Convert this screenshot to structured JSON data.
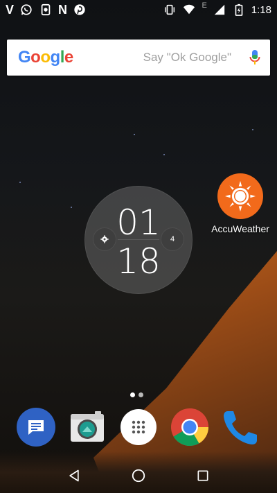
{
  "status_bar": {
    "left_icons": [
      "vodafone-v-icon",
      "whatsapp-icon",
      "screenshot-icon",
      "news-n-icon",
      "pinterest-icon"
    ],
    "v_letter": "V",
    "n_letter": "N",
    "network_type": "E",
    "time": "1:18"
  },
  "search": {
    "logo": [
      "G",
      "o",
      "o",
      "g",
      "l",
      "e"
    ],
    "hint": "Say \"Ok Google\""
  },
  "clock": {
    "hour": "01",
    "minute": "18",
    "badge_count": "4"
  },
  "apps": {
    "accuweather_label": "AccuWeather"
  },
  "dock": {
    "apps": [
      "messages-icon",
      "camera-icon",
      "app-drawer-icon",
      "chrome-icon",
      "phone-icon"
    ]
  },
  "colors": {
    "accuweather": "#f26a1b",
    "messages": "#2f62c4",
    "phone": "#1e88e5"
  }
}
